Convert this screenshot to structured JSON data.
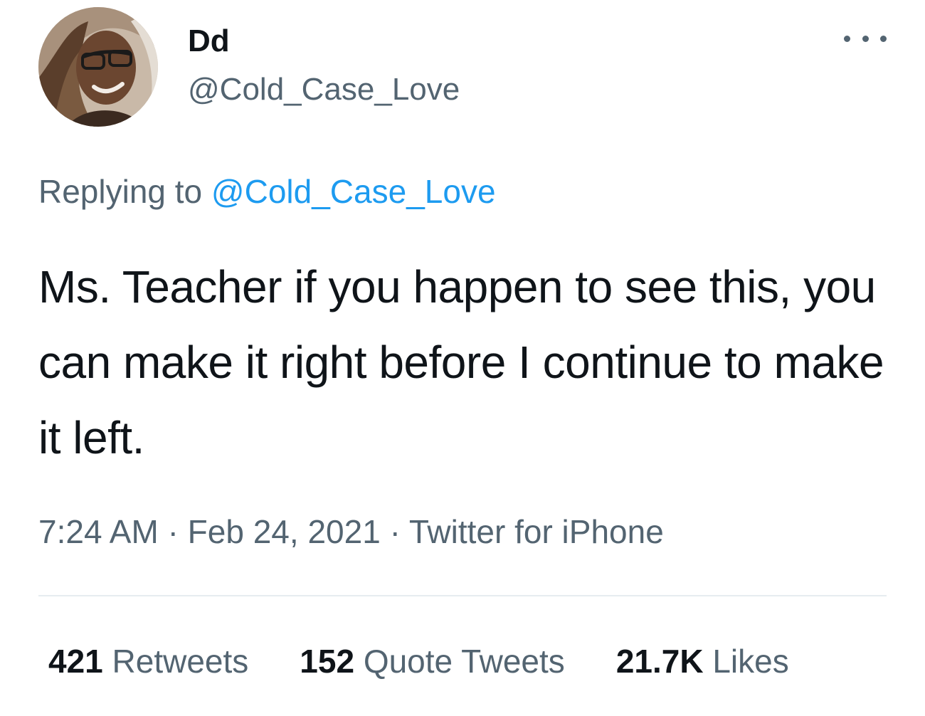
{
  "author": {
    "display_name": "Dd",
    "handle": "@Cold_Case_Love"
  },
  "reply": {
    "prefix": "Replying to",
    "mention": "@Cold_Case_Love"
  },
  "tweet": {
    "text": "Ms. Teacher if you happen to see this, you can make it right before I continue to make it left."
  },
  "meta": {
    "time": "7:24 AM",
    "date": "Feb 24, 2021",
    "source": "Twitter for iPhone",
    "separator": "·"
  },
  "stats": {
    "retweets_count": "421",
    "retweets_label": "Retweets",
    "quotes_count": "152",
    "quotes_label": "Quote Tweets",
    "likes_count": "21.7K",
    "likes_label": "Likes"
  },
  "icons": {
    "more": "more-options-icon",
    "avatar": "profile-photo"
  },
  "colors": {
    "accent": "#1d9bf0",
    "text": "#0f1419",
    "secondary": "#536471",
    "divider": "#e6ecf0"
  }
}
